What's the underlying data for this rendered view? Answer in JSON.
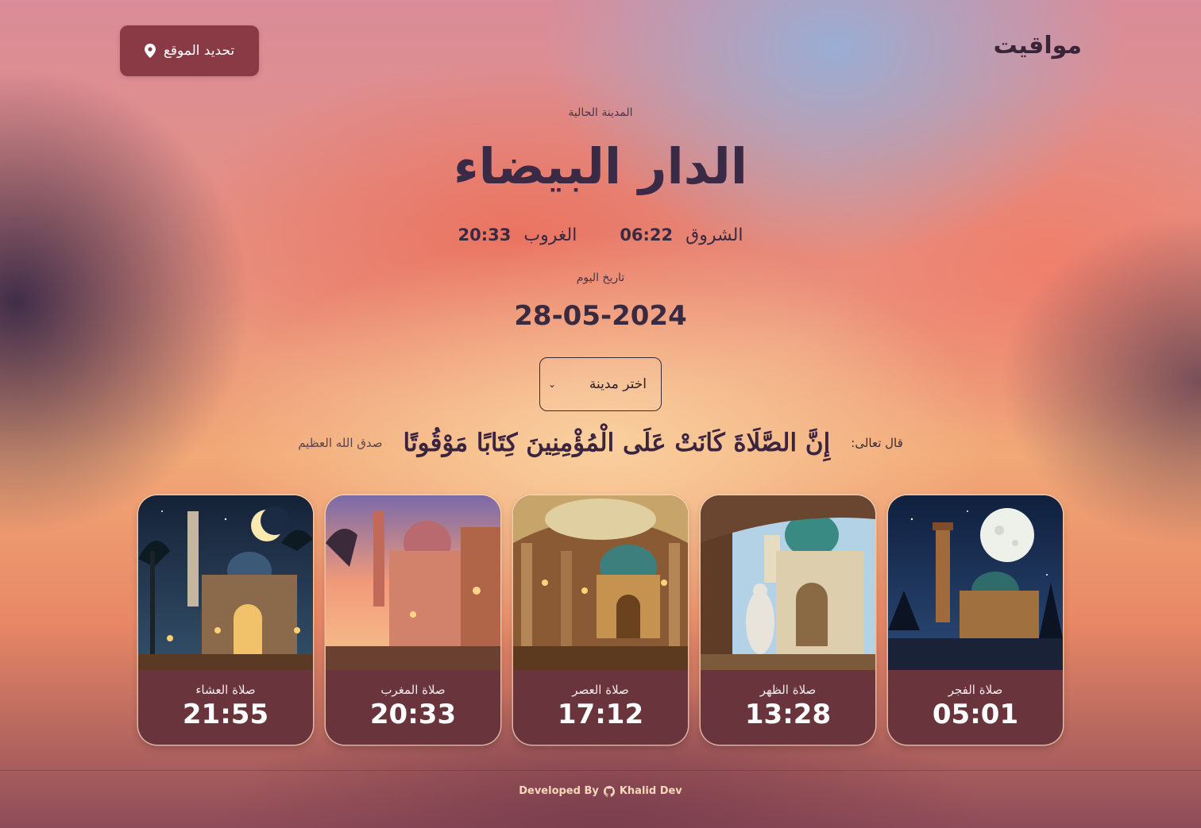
{
  "header": {
    "logo": "مواقيت",
    "locate_button": "تحديد الموقع",
    "locate_icon": "map-pin-icon"
  },
  "location": {
    "label": "المدينة الحالية",
    "city": "الدار البيضاء"
  },
  "sun": {
    "sunrise_label": "الشروق",
    "sunrise_time": "06:22",
    "sunset_label": "الغروب",
    "sunset_time": "20:33"
  },
  "date": {
    "label": "تاريخ اليوم",
    "value": "28-05-2024"
  },
  "city_select": {
    "selected": "اختر مدينة"
  },
  "verse": {
    "intro": "قال تعالى:",
    "text": "إِنَّ الصَّلَاةَ كَانَتْ عَلَى الْمُؤْمِنِينَ كِتَابًا مَوْقُوتًا",
    "outro": "صدق الله العظيم"
  },
  "prayers": [
    {
      "name": "صلاة الفجر",
      "time": "05:01",
      "scene": "night-moon-mosque"
    },
    {
      "name": "صلاة الظهر",
      "time": "13:28",
      "scene": "daylight-arches-mosque"
    },
    {
      "name": "صلاة العصر",
      "time": "17:12",
      "scene": "mosque-interior-dome"
    },
    {
      "name": "صلاة المغرب",
      "time": "20:33",
      "scene": "sunset-mosque-street"
    },
    {
      "name": "صلاة العشاء",
      "time": "21:55",
      "scene": "crescent-night-mosque"
    }
  ],
  "footer": {
    "developed_by": "Developed By",
    "author": "Khalid Dev",
    "icon": "github-icon"
  },
  "colors": {
    "button": "#8a3a44",
    "card": "#6a343c",
    "text_dark": "#3a2a46",
    "footer_text": "#f5d9b8"
  }
}
